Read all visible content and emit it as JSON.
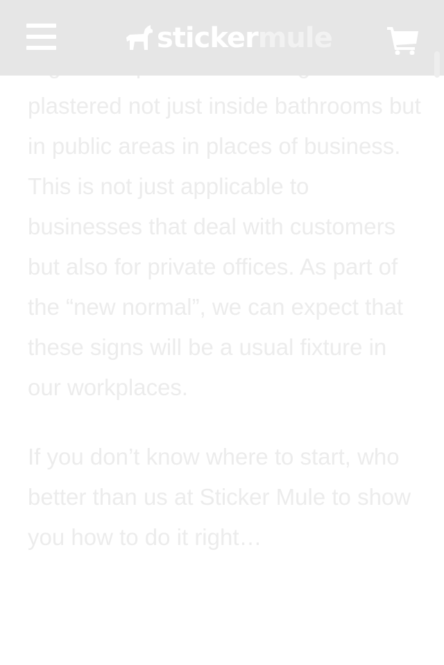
{
  "header": {
    "menu_icon": "hamburger-menu-icon",
    "logo": {
      "icon": "mule-icon",
      "word_sticker": "sticker",
      "word_mule": "mule"
    },
    "cart_icon": "shopping-cart-icon"
  },
  "article": {
    "paragraph_1": "Signs that promote washing should be plastered not just inside bathrooms but in public areas in places of business. This is not just applicable to businesses that deal with customers but also for private offices. As part of the “new normal”, we can expect that these signs will be a usual fixture in our workplaces.",
    "paragraph_2": "If you don’t know where to start, who better than us at Sticker Mule to show you how to do it right…"
  },
  "colors": {
    "header_bg": "#e6e6e6",
    "header_fg": "#ffffff",
    "text": "#ececec"
  }
}
